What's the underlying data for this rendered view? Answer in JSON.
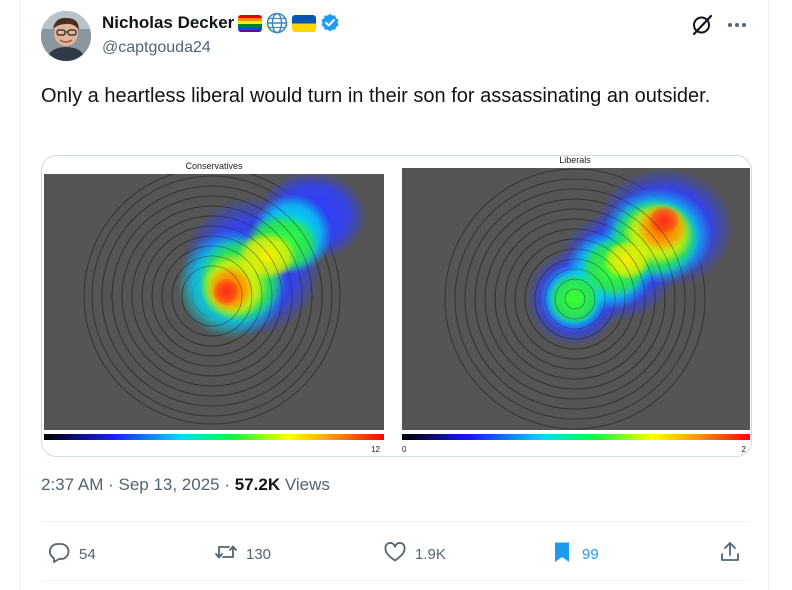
{
  "author": {
    "display_name": "Nicholas Decker",
    "handle": "@captgouda24",
    "name_emojis": [
      "rainbow-flag",
      "globe",
      "ukraine-flag"
    ],
    "verified_color": "#1d9bf0"
  },
  "tweet": {
    "text": "Only a heartless liberal would turn in their son for assassinating an outsider.",
    "time": "2:37 AM",
    "separator": " · ",
    "date": "Sep 13, 2025",
    "views_count": "57.2K",
    "views_label": "Views"
  },
  "media": {
    "left_panel": {
      "title": "Conservatives",
      "scale_max": "12"
    },
    "right_panel": {
      "title": "Liberals",
      "scale_min": "0",
      "scale_max": "2"
    }
  },
  "actions": {
    "replies": "54",
    "reposts": "130",
    "likes": "1.9K",
    "bookmarks": "99"
  },
  "colors": {
    "text_primary": "#0f1419",
    "text_secondary": "#536471",
    "accent": "#1d9bf0",
    "border": "#cfd9de",
    "heatmap_background": "#555555"
  },
  "icons": [
    "grok-icon",
    "more-icon",
    "reply-icon",
    "repost-icon",
    "like-icon",
    "bookmark-icon",
    "share-icon"
  ]
}
